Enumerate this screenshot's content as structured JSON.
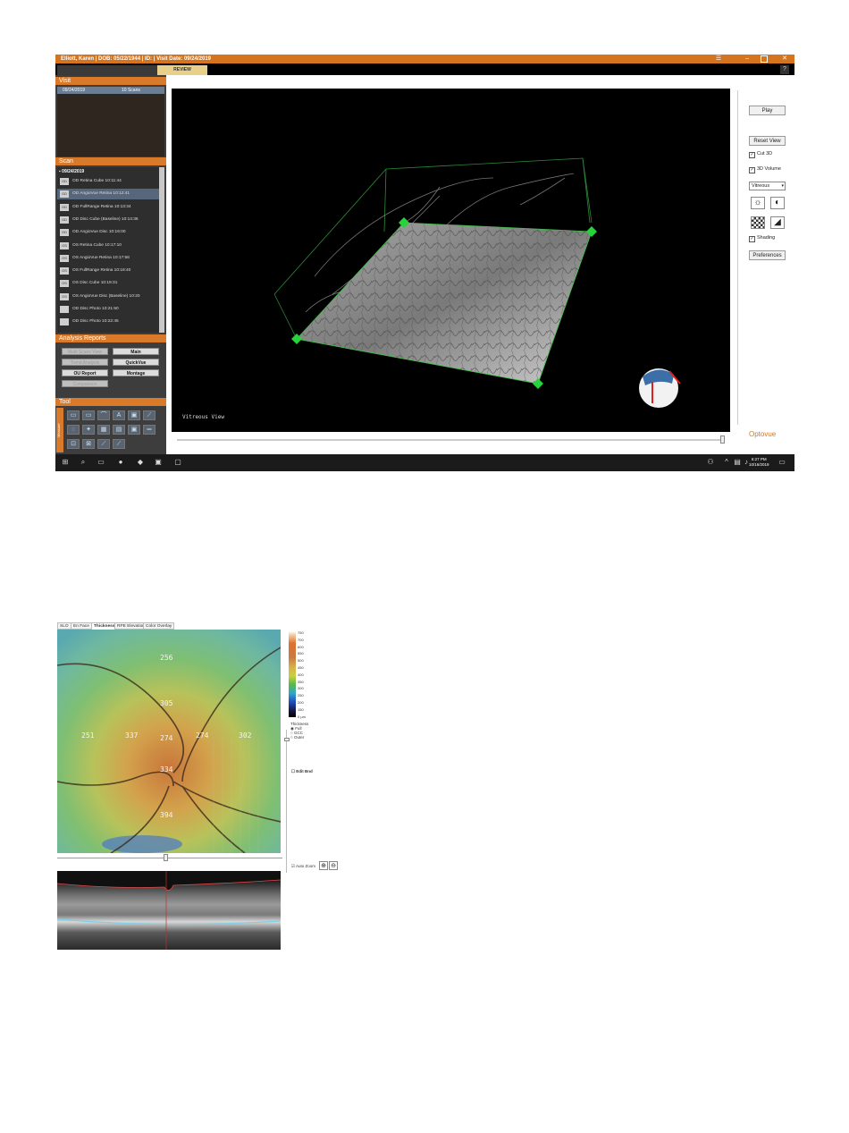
{
  "app": {
    "title": "Elliott, Karen  |  DOB: 05/22/1944  |  ID:  |  Visit Date: 09/24/2019",
    "tabs": [
      "",
      "",
      "REVIEW"
    ],
    "active_tab": "REVIEW"
  },
  "visit": {
    "header": "Visit",
    "date": "09/24/2019",
    "scans": "10 Scans"
  },
  "scan": {
    "header": "Scan",
    "group": "09/24/2019",
    "items": [
      {
        "icon": "OD",
        "label": "OD Retina Cube  10:11:44"
      },
      {
        "icon": "OD",
        "label": "OD AngioVue Retina  10:12:41"
      },
      {
        "icon": "OD",
        "label": "OD FullRange Retina  10:13:34"
      },
      {
        "icon": "OD",
        "label": "OD Disc Cube (Baseline)  10:14:36"
      },
      {
        "icon": "OD",
        "label": "OD AngioVue Disc  10:16:00"
      },
      {
        "icon": "OS",
        "label": "OS Retina Cube  10:17:10"
      },
      {
        "icon": "OS",
        "label": "OS AngioVue Retina  10:17:58"
      },
      {
        "icon": "OS",
        "label": "OS FullRange Retina  10:18:40"
      },
      {
        "icon": "OS",
        "label": "OS Disc Cube  10:19:31"
      },
      {
        "icon": "OS",
        "label": "OS AngioVue Disc (Baseline)  10:20"
      },
      {
        "icon": "",
        "label": "OD Disc Photo  10:21:50"
      },
      {
        "icon": "",
        "label": "OD Disc Photo  10:22:45"
      }
    ],
    "selected_index": 1
  },
  "analysis": {
    "header": "Analysis Reports",
    "buttons": [
      {
        "label": "Multi Scans View",
        "style": "dim"
      },
      {
        "label": "Main",
        "style": "bold"
      },
      {
        "label": "Trend Analysis",
        "style": "dim"
      },
      {
        "label": "QuickVue",
        "style": "bold"
      },
      {
        "label": "OU Report",
        "style": "bold"
      },
      {
        "label": "Montage",
        "style": "bold"
      },
      {
        "label": "Comparison",
        "style": "dim"
      }
    ]
  },
  "tool": {
    "header": "Tool",
    "side_label": "Measure"
  },
  "viewer": {
    "view_label": "Vitreous View"
  },
  "right_panel": {
    "play": "Play",
    "reset_view": "Reset View",
    "cut_3d": "Cut 3D",
    "volume_3d": "3D Volume",
    "layer_select": "Vitreous",
    "shading": "Shading",
    "preferences": "Preferences",
    "logo": "Optovue"
  },
  "taskbar": {
    "time": "6:27 PM",
    "date": "10/16/2019"
  },
  "thickness_view": {
    "tabs": [
      "SLO",
      "En Face",
      "Thickness",
      "RPE Elevation",
      "Color Overlay"
    ],
    "active_tab": "Thickness",
    "values": {
      "top": "256",
      "upper": "305",
      "left_outer": "251",
      "left_inner": "337",
      "center": "274",
      "right_inner": "274",
      "right_outer": "302",
      "lower": "334",
      "bottom": "394"
    },
    "colorbar_ticks": [
      "750",
      "700",
      "600",
      "550",
      "500",
      "450",
      "400",
      "350",
      "300",
      "250",
      "200",
      "150",
      "0 µm"
    ],
    "thickness_label": "Thickness",
    "options": [
      "Full",
      "GCC",
      "Outer"
    ],
    "edit_bnd": "Edit Bnd",
    "auto_zoom": "Auto Zoom"
  }
}
